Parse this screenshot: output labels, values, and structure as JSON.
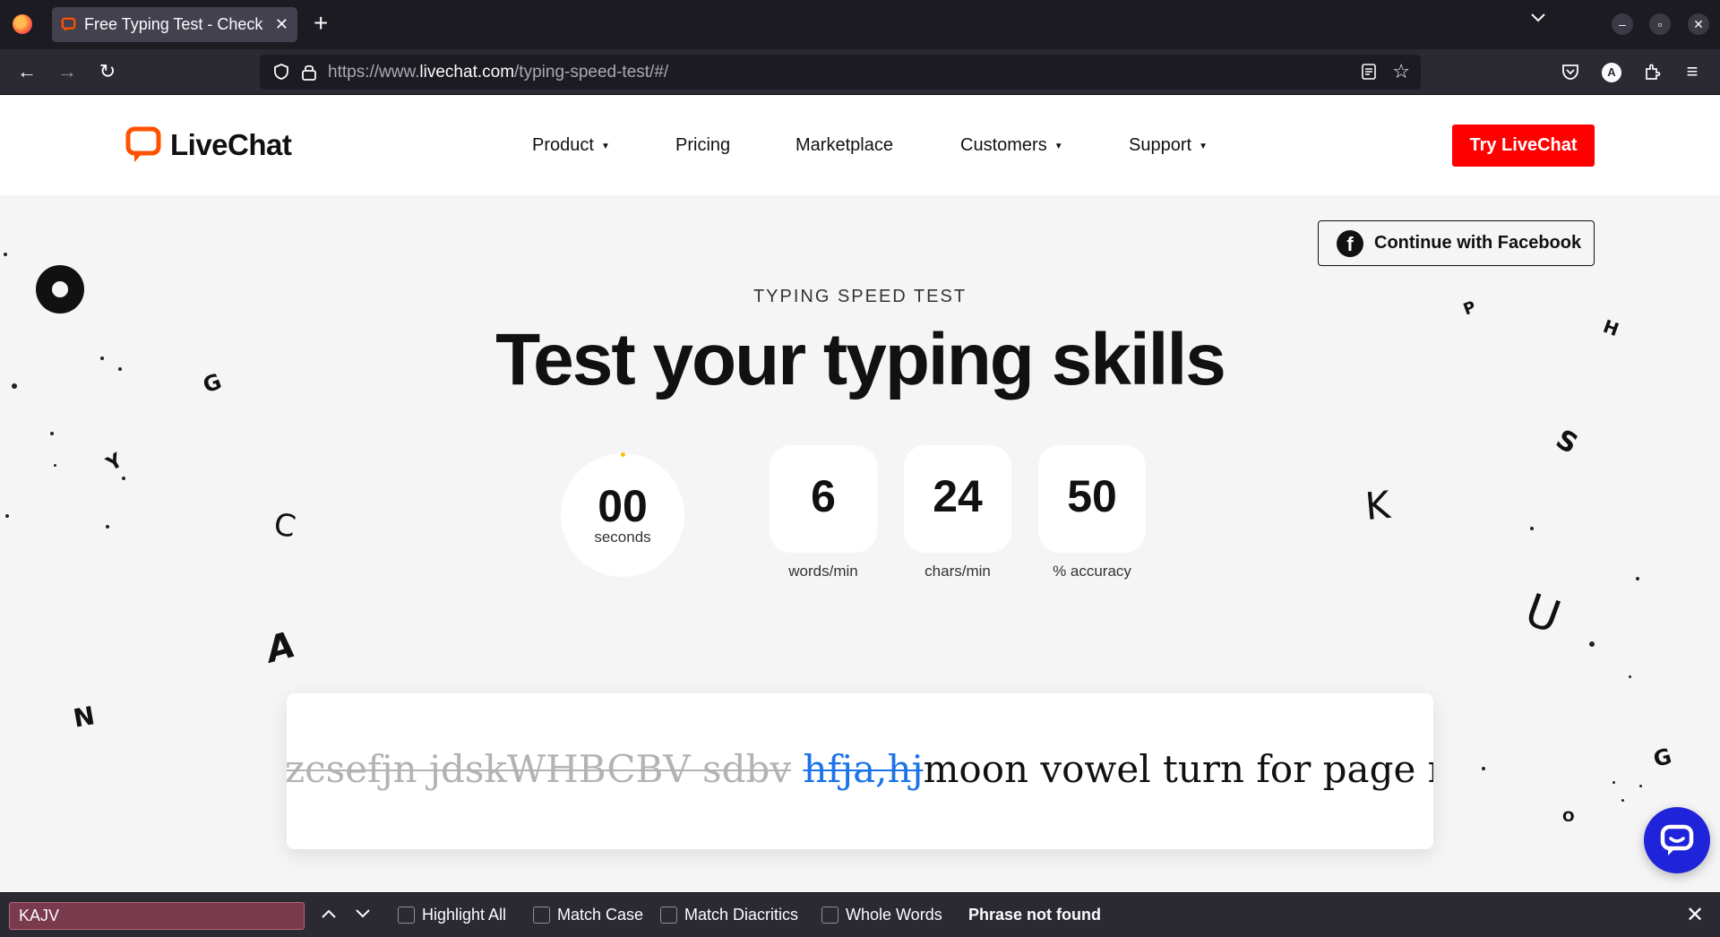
{
  "browser": {
    "tab_title": "Free Typing Test - Check Your Typing Speed",
    "tab_close": "✕",
    "new_tab": "+",
    "url_prefix": "https://www.",
    "url_host": "livechat.com",
    "url_path": "/typing-speed-test/#/",
    "icons": [
      "firefox-icon",
      "back-icon",
      "forward-icon",
      "reload-icon",
      "shield-icon",
      "lock-icon",
      "reader-view-icon",
      "bookmark-star-icon",
      "pocket-icon",
      "account-icon",
      "extensions-icon",
      "menu-icon"
    ]
  },
  "site": {
    "logo_text": "LiveChat",
    "nav": [
      {
        "label": "Product",
        "caret": true
      },
      {
        "label": "Pricing",
        "caret": false
      },
      {
        "label": "Marketplace",
        "caret": false
      },
      {
        "label": "Customers",
        "caret": true
      },
      {
        "label": "Support",
        "caret": true
      }
    ],
    "caret_glyph": "▼",
    "cta_label": "Try LiveChat",
    "brand_color": "#ff5100",
    "cta_color": "#ff0000"
  },
  "hero": {
    "facebook_label": "Continue with Facebook",
    "eyebrow": "TYPING SPEED TEST",
    "headline": "Test your typing skills",
    "timer": {
      "value": "00",
      "unit": "seconds"
    },
    "stats": [
      {
        "value": "6",
        "unit": "words/min"
      },
      {
        "value": "24",
        "unit": "chars/min"
      },
      {
        "value": "50",
        "unit": "% accuracy"
      }
    ]
  },
  "test": {
    "typed_words": "zcsefjn jdskWHBCBV sdbv",
    "current_word": "hfja,hj",
    "upcoming_text": "moon vowel turn for page mother"
  },
  "decorations": [
    "O",
    "G",
    "Y",
    "C",
    "A",
    "N",
    "P",
    "H",
    "S",
    "K",
    "U",
    "G",
    "O"
  ],
  "findbar": {
    "query": "KAJV",
    "options": [
      "Highlight All",
      "Match Case",
      "Match Diacritics",
      "Whole Words"
    ],
    "status": "Phrase not found",
    "up_arrow": "⌃",
    "down_arrow": "⌄",
    "close": "✕"
  }
}
